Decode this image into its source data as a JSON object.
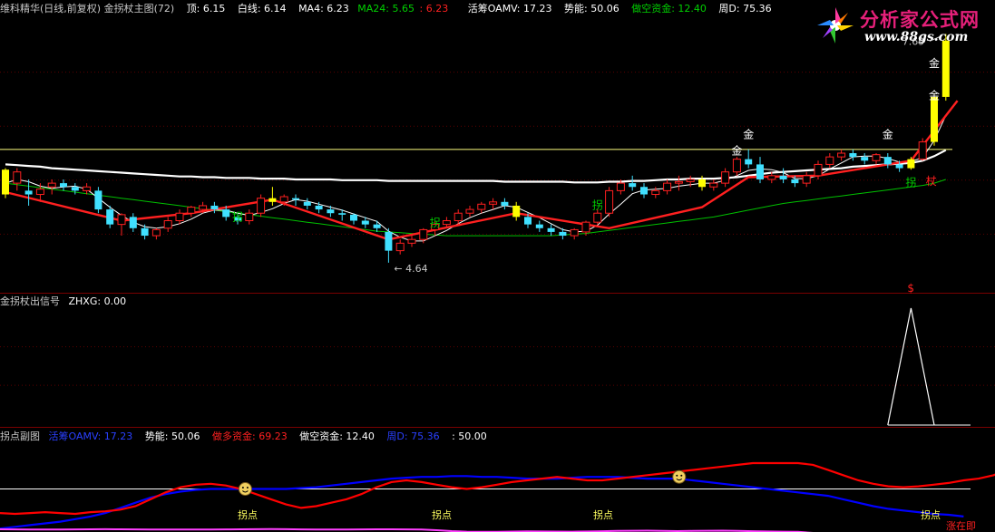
{
  "colors": {
    "white_line": "#ffffff",
    "ma4": "#ffffff",
    "ma24": "#00c000",
    "up": "#ff2020",
    "down": "#40e0ff",
    "gold": "#ffff00",
    "level": "#ffff80",
    "signal": "#ffffff",
    "oamv": "#0000ff",
    "short_fund": "#ff0000",
    "momentum": "#ff40ff",
    "mid": "#ffffff"
  },
  "main": {
    "title": "维科精华(日线,前复权) 金拐杖主图(72)",
    "top_label": "顶: 6.15",
    "white_label": "白线: 6.14",
    "ma4_label": "MA4: 6.23",
    "ma24_label": "MA24: 5.65",
    "ma24_extra": ": 6.23",
    "oamv_label": "活筹OAMV: 17.23",
    "power_label": "势能: 50.06",
    "short_label": "做空资金: 12.40",
    "weekd_label": "周D: 75.36"
  },
  "signal": {
    "title": "金拐杖出信号",
    "value": "ZHXG: 0.00",
    "dollar": "$"
  },
  "sub": {
    "title": "拐点副图",
    "oamv": "活筹OAMV: 17.23",
    "power": "势能: 50.06",
    "long_fund": "做多资金: 69.23",
    "short_fund": "做空资金: 12.40",
    "weekd": "周D: 75.36",
    "extra": ": 50.00"
  },
  "logo": {
    "title": "分析家公式网",
    "url": "www.88gs.com"
  },
  "annotations": {
    "gold": "金",
    "crutch": "拐",
    "staff": "杖",
    "turn": "拐点",
    "rise": "涨在即",
    "high_price": "7.69",
    "low_price": "4.64"
  },
  "chart_data": {
    "type": "candlestick",
    "title": "维科精华(日线,前复权) 金拐杖主图(72)",
    "y_range": [
      4.3,
      7.9
    ],
    "level_line": 6.15,
    "high_mark": 7.69,
    "low_mark": 4.64,
    "candles": [
      [
        5.55,
        5.9,
        5.5,
        5.88
      ],
      [
        5.7,
        5.9,
        5.6,
        5.85
      ],
      [
        5.6,
        5.75,
        5.4,
        5.55
      ],
      [
        5.55,
        5.7,
        5.45,
        5.62
      ],
      [
        5.65,
        5.75,
        5.55,
        5.7
      ],
      [
        5.7,
        5.75,
        5.6,
        5.65
      ],
      [
        5.65,
        5.7,
        5.55,
        5.6
      ],
      [
        5.6,
        5.7,
        5.55,
        5.65
      ],
      [
        5.6,
        5.65,
        5.3,
        5.35
      ],
      [
        5.35,
        5.4,
        5.1,
        5.15
      ],
      [
        5.15,
        5.3,
        5.0,
        5.28
      ],
      [
        5.25,
        5.3,
        5.05,
        5.1
      ],
      [
        5.1,
        5.15,
        4.95,
        5.0
      ],
      [
        5.0,
        5.1,
        4.95,
        5.08
      ],
      [
        5.1,
        5.25,
        5.05,
        5.2
      ],
      [
        5.2,
        5.35,
        5.15,
        5.3
      ],
      [
        5.3,
        5.4,
        5.25,
        5.38
      ],
      [
        5.35,
        5.45,
        5.3,
        5.4
      ],
      [
        5.4,
        5.45,
        5.3,
        5.35
      ],
      [
        5.35,
        5.4,
        5.2,
        5.25
      ],
      [
        5.25,
        5.3,
        5.15,
        5.2
      ],
      [
        5.2,
        5.35,
        5.15,
        5.3
      ],
      [
        5.3,
        5.55,
        5.25,
        5.5
      ],
      [
        5.5,
        5.65,
        5.4,
        5.45
      ],
      [
        5.45,
        5.55,
        5.4,
        5.52
      ],
      [
        5.5,
        5.55,
        5.4,
        5.48
      ],
      [
        5.45,
        5.5,
        5.35,
        5.4
      ],
      [
        5.4,
        5.45,
        5.3,
        5.35
      ],
      [
        5.35,
        5.4,
        5.25,
        5.3
      ],
      [
        5.3,
        5.35,
        5.2,
        5.28
      ],
      [
        5.28,
        5.3,
        5.15,
        5.2
      ],
      [
        5.2,
        5.25,
        5.1,
        5.15
      ],
      [
        5.15,
        5.2,
        5.05,
        5.1
      ],
      [
        5.05,
        5.1,
        4.64,
        4.8
      ],
      [
        4.8,
        4.95,
        4.75,
        4.9
      ],
      [
        4.9,
        5.0,
        4.85,
        4.95
      ],
      [
        4.95,
        5.1,
        4.9,
        5.08
      ],
      [
        5.08,
        5.2,
        5.0,
        5.15
      ],
      [
        5.15,
        5.25,
        5.1,
        5.2
      ],
      [
        5.2,
        5.35,
        5.15,
        5.3
      ],
      [
        5.3,
        5.4,
        5.25,
        5.35
      ],
      [
        5.35,
        5.45,
        5.3,
        5.42
      ],
      [
        5.42,
        5.5,
        5.35,
        5.45
      ],
      [
        5.45,
        5.5,
        5.35,
        5.4
      ],
      [
        5.4,
        5.45,
        5.2,
        5.25
      ],
      [
        5.25,
        5.3,
        5.1,
        5.15
      ],
      [
        5.15,
        5.2,
        5.05,
        5.1
      ],
      [
        5.1,
        5.15,
        5.0,
        5.05
      ],
      [
        5.05,
        5.1,
        4.95,
        5.0
      ],
      [
        5.0,
        5.1,
        4.95,
        5.08
      ],
      [
        5.05,
        5.2,
        5.0,
        5.18
      ],
      [
        5.18,
        5.35,
        5.15,
        5.3
      ],
      [
        5.3,
        5.65,
        5.25,
        5.6
      ],
      [
        5.6,
        5.75,
        5.55,
        5.7
      ],
      [
        5.7,
        5.8,
        5.6,
        5.65
      ],
      [
        5.65,
        5.7,
        5.5,
        5.55
      ],
      [
        5.55,
        5.65,
        5.5,
        5.6
      ],
      [
        5.6,
        5.75,
        5.55,
        5.7
      ],
      [
        5.7,
        5.8,
        5.6,
        5.72
      ],
      [
        5.72,
        5.8,
        5.65,
        5.75
      ],
      [
        5.75,
        5.8,
        5.6,
        5.65
      ],
      [
        5.65,
        5.75,
        5.6,
        5.7
      ],
      [
        5.7,
        5.9,
        5.65,
        5.85
      ],
      [
        5.85,
        6.05,
        5.8,
        6.02
      ],
      [
        6.02,
        6.15,
        5.9,
        5.95
      ],
      [
        5.95,
        6.05,
        5.7,
        5.75
      ],
      [
        5.75,
        5.85,
        5.7,
        5.8
      ],
      [
        5.8,
        5.9,
        5.7,
        5.75
      ],
      [
        5.75,
        5.8,
        5.65,
        5.7
      ],
      [
        5.7,
        5.85,
        5.65,
        5.8
      ],
      [
        5.8,
        6.0,
        5.75,
        5.95
      ],
      [
        5.95,
        6.1,
        5.9,
        6.05
      ],
      [
        6.05,
        6.15,
        6.0,
        6.1
      ],
      [
        6.1,
        6.15,
        6.0,
        6.05
      ],
      [
        6.05,
        6.1,
        5.95,
        6.0
      ],
      [
        6.0,
        6.1,
        5.95,
        6.08
      ],
      [
        6.05,
        6.1,
        5.9,
        5.95
      ],
      [
        5.95,
        6.0,
        5.85,
        5.9
      ],
      [
        5.9,
        6.05,
        5.88,
        6.02
      ],
      [
        6.02,
        6.3,
        6.0,
        6.25
      ],
      [
        6.25,
        6.9,
        6.2,
        6.85
      ],
      [
        6.85,
        7.69,
        6.8,
        7.6
      ]
    ],
    "gold_bars": [
      0,
      23,
      44,
      60,
      78,
      80,
      81
    ],
    "white_line": [
      5.95,
      5.94,
      5.93,
      5.92,
      5.9,
      5.89,
      5.88,
      5.87,
      5.86,
      5.85,
      5.84,
      5.83,
      5.82,
      5.81,
      5.8,
      5.79,
      5.79,
      5.78,
      5.78,
      5.77,
      5.77,
      5.77,
      5.76,
      5.76,
      5.76,
      5.75,
      5.75,
      5.75,
      5.75,
      5.74,
      5.74,
      5.74,
      5.74,
      5.73,
      5.73,
      5.73,
      5.73,
      5.73,
      5.73,
      5.73,
      5.73,
      5.73,
      5.73,
      5.72,
      5.72,
      5.72,
      5.72,
      5.72,
      5.72,
      5.71,
      5.71,
      5.71,
      5.72,
      5.72,
      5.73,
      5.73,
      5.74,
      5.75,
      5.75,
      5.76,
      5.76,
      5.76,
      5.77,
      5.78,
      5.8,
      5.82,
      5.84,
      5.85,
      5.86,
      5.87,
      5.88,
      5.89,
      5.9,
      5.92,
      5.93,
      5.94,
      5.95,
      5.96,
      5.97,
      6.0,
      6.06,
      6.14
    ],
    "ma24": [
      5.7,
      5.68,
      5.66,
      5.64,
      5.62,
      5.6,
      5.58,
      5.56,
      5.54,
      5.52,
      5.5,
      5.48,
      5.46,
      5.44,
      5.42,
      5.4,
      5.38,
      5.36,
      5.34,
      5.32,
      5.3,
      5.28,
      5.26,
      5.24,
      5.22,
      5.2,
      5.18,
      5.16,
      5.14,
      5.12,
      5.1,
      5.08,
      5.06,
      5.05,
      5.04,
      5.03,
      5.02,
      5.01,
      5.0,
      5.0,
      5.0,
      5.0,
      5.0,
      5.0,
      5.0,
      5.0,
      5.0,
      5.0,
      5.01,
      5.02,
      5.03,
      5.05,
      5.07,
      5.09,
      5.11,
      5.13,
      5.15,
      5.17,
      5.19,
      5.21,
      5.23,
      5.25,
      5.28,
      5.31,
      5.34,
      5.37,
      5.4,
      5.43,
      5.45,
      5.47,
      5.49,
      5.51,
      5.53,
      5.55,
      5.57,
      5.59,
      5.61,
      5.63,
      5.65,
      5.67,
      5.7,
      5.75
    ],
    "ma4": [
      5.7,
      5.75,
      5.72,
      5.66,
      5.63,
      5.65,
      5.66,
      5.62,
      5.5,
      5.38,
      5.27,
      5.18,
      5.12,
      5.1,
      5.12,
      5.16,
      5.22,
      5.3,
      5.34,
      5.34,
      5.3,
      5.27,
      5.31,
      5.36,
      5.43,
      5.48,
      5.46,
      5.42,
      5.38,
      5.34,
      5.29,
      5.24,
      5.19,
      5.06,
      4.98,
      4.93,
      4.93,
      5.0,
      5.07,
      5.16,
      5.24,
      5.3,
      5.35,
      5.4,
      5.38,
      5.31,
      5.24,
      5.16,
      5.08,
      5.05,
      5.06,
      5.14,
      5.29,
      5.42,
      5.56,
      5.61,
      5.62,
      5.63,
      5.66,
      5.68,
      5.7,
      5.7,
      5.74,
      5.8,
      5.87,
      5.89,
      5.88,
      5.84,
      5.76,
      5.76,
      5.8,
      5.89,
      5.97,
      6.05,
      6.06,
      6.06,
      6.03,
      5.98,
      5.99,
      6.04,
      6.27,
      6.6
    ],
    "red_trend": [
      [
        0,
        5.58
      ],
      [
        10,
        5.2
      ],
      [
        16,
        5.3
      ],
      [
        23,
        5.48
      ],
      [
        33,
        4.95
      ],
      [
        44,
        5.3
      ],
      [
        52,
        5.1
      ],
      [
        60,
        5.38
      ],
      [
        64,
        5.78
      ],
      [
        70,
        5.8
      ],
      [
        78,
        6.0
      ],
      [
        82,
        6.8
      ]
    ],
    "signal_spike": [
      [
        76,
        0
      ],
      [
        78,
        1
      ],
      [
        80,
        0
      ]
    ],
    "sub": {
      "mid": 50,
      "y_range": [
        0,
        100
      ],
      "oamv": [
        4,
        6,
        8,
        10,
        12,
        15,
        18,
        22,
        28,
        34,
        40,
        44,
        47,
        49,
        50,
        50,
        50,
        50,
        50,
        50,
        51,
        52,
        54,
        56,
        58,
        60,
        62,
        63,
        64,
        64,
        65,
        65,
        64,
        64,
        63,
        62,
        62,
        62,
        63,
        64,
        64,
        64,
        63,
        62,
        62,
        62,
        60,
        58,
        56,
        54,
        52,
        50,
        48,
        46,
        44,
        42,
        38,
        34,
        30,
        27,
        25,
        23,
        21,
        20,
        18
      ],
      "long_fund": [
        22,
        21,
        22,
        23,
        22,
        21,
        23,
        24,
        26,
        30,
        38,
        46,
        52,
        55,
        56,
        54,
        50,
        44,
        38,
        32,
        28,
        30,
        34,
        38,
        44,
        52,
        58,
        60,
        58,
        55,
        52,
        50,
        52,
        55,
        58,
        60,
        62,
        64,
        62,
        60,
        60,
        62,
        64,
        66,
        68,
        70,
        72,
        74,
        76,
        78,
        80,
        80,
        80,
        80,
        78,
        72,
        66,
        60,
        56,
        53,
        52,
        53,
        55,
        57,
        60,
        62,
        66,
        74,
        90
      ],
      "momentum": [
        -60,
        -58,
        -56,
        -55,
        -56,
        -58,
        -60,
        -62,
        -60,
        -58,
        -56,
        -55,
        -55,
        -55,
        -56,
        -58,
        -60,
        -62,
        -64,
        -62,
        -58,
        -55,
        -55,
        -56,
        -58,
        -60,
        -60,
        -58,
        -55,
        -40,
        -20,
        -8,
        -4,
        -6,
        -10,
        -15,
        -12,
        -10,
        -8,
        -12,
        -18,
        -24,
        -28,
        -30,
        -26,
        -20,
        -24,
        -28,
        -30,
        -24,
        -18,
        -12,
        -8,
        -4,
        20,
        60,
        92
      ],
      "smiley_positions": [
        [
          13,
          50
        ],
        [
          36,
          64
        ]
      ],
      "turn_points": [
        13,
        23,
        33,
        48
      ],
      "rise_point": 50
    }
  }
}
